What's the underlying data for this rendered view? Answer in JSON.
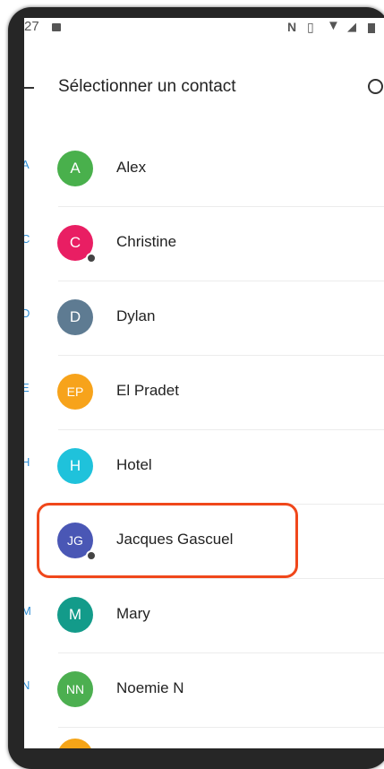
{
  "status": {
    "time": "27"
  },
  "header": {
    "title": "Sélectionner un contact"
  },
  "contacts": [
    {
      "section": "A",
      "initials": "A",
      "name": "Alex",
      "color": "#49b04c",
      "badge": false
    },
    {
      "section": "C",
      "initials": "C",
      "name": "Christine",
      "color": "#e91e63",
      "badge": true
    },
    {
      "section": "D",
      "initials": "D",
      "name": "Dylan",
      "color": "#5e7b92",
      "badge": false
    },
    {
      "section": "E",
      "initials": "EP",
      "name": "El Pradet",
      "color": "#f7a31b",
      "badge": false
    },
    {
      "section": "H",
      "initials": "H",
      "name": "Hotel",
      "color": "#1fc2db",
      "badge": false
    },
    {
      "section": "",
      "initials": "JG",
      "name": "Jacques Gascuel",
      "color": "#4a57b5",
      "badge": true
    },
    {
      "section": "M",
      "initials": "M",
      "name": "Mary",
      "color": "#139b8a",
      "badge": false
    },
    {
      "section": "N",
      "initials": "NN",
      "name": "Noemie N",
      "color": "#4caf50",
      "badge": false
    }
  ],
  "highlight_color": "#f0471b"
}
